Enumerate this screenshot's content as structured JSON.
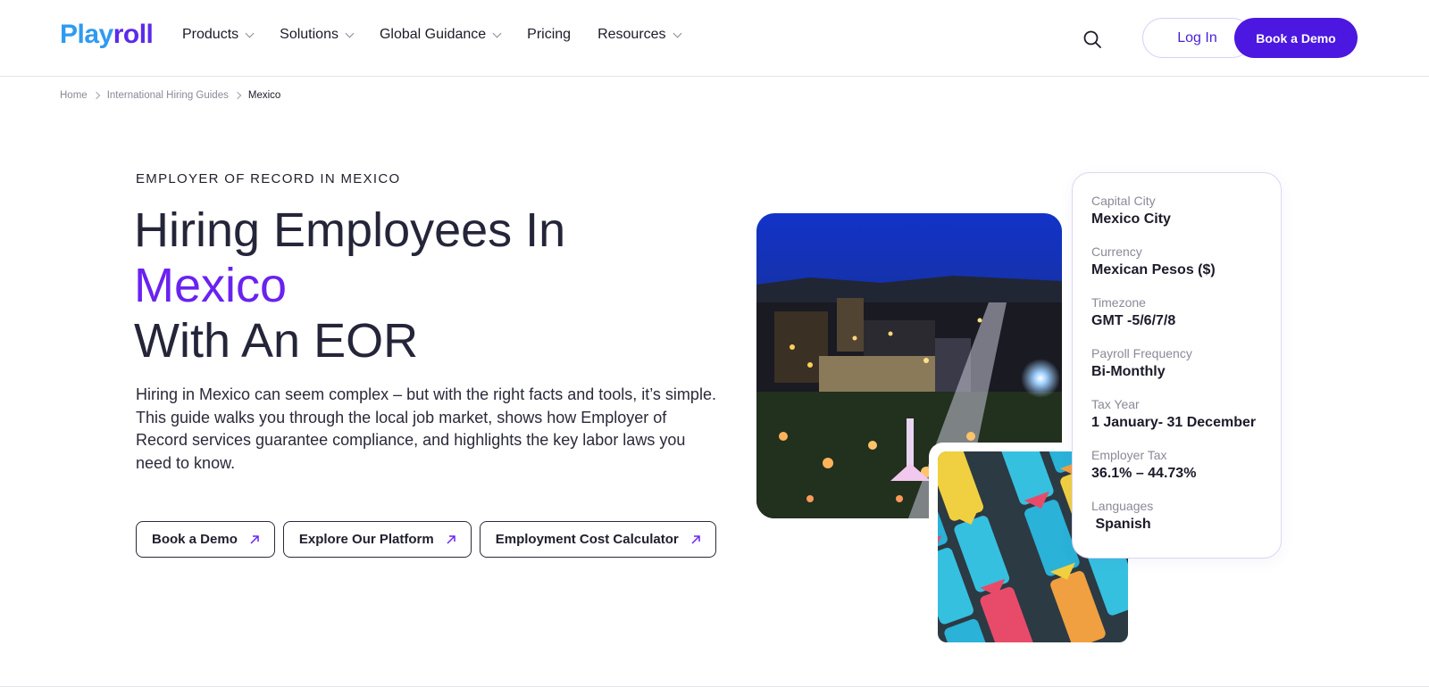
{
  "header": {
    "logo_part1": "Play",
    "logo_part2": "roll",
    "nav": [
      {
        "label": "Products",
        "dropdown": true
      },
      {
        "label": "Solutions",
        "dropdown": true
      },
      {
        "label": "Global Guidance",
        "dropdown": true
      },
      {
        "label": "Pricing",
        "dropdown": false
      },
      {
        "label": "Resources",
        "dropdown": true
      }
    ],
    "search_icon": "search-icon",
    "login_label": "Log In",
    "demo_label": "Book a Demo"
  },
  "breadcrumb": {
    "items": [
      "Home",
      "International Hiring Guides"
    ],
    "current": "Mexico"
  },
  "hero": {
    "eyebrow": "EMPLOYER OF RECORD IN MEXICO",
    "headline_line1": "Hiring Employees In",
    "headline_accent": "Mexico",
    "headline_line3": "With An EOR",
    "intro": "Hiring in Mexico can seem complex – but with the right facts and tools, it’s simple. This guide walks you through the local job market, shows how Employer of Record services guarantee compliance, and highlights the key labor laws you need to know.",
    "ctas": [
      "Book a Demo",
      "Explore Our Platform",
      "Employment Cost Calculator"
    ]
  },
  "facts": [
    {
      "label": "Capital City",
      "value": "Mexico City"
    },
    {
      "label": "Currency",
      "value": "Mexican Pesos ($)"
    },
    {
      "label": "Timezone",
      "value": "GMT -5/6/7/8"
    },
    {
      "label": "Payroll Frequency",
      "value": "Bi-Monthly"
    },
    {
      "label": "Tax Year",
      "value": "1 January- 31 December"
    },
    {
      "label": "Employer Tax",
      "value": "36.1% – 44.73%"
    },
    {
      "label": "Languages",
      "value": " Spanish"
    }
  ],
  "colors": {
    "brand_blue": "#2e9bf0",
    "brand_purple": "#5b2bea",
    "accent_purple": "#6a22f0",
    "cta_purple": "#4c17e0"
  }
}
